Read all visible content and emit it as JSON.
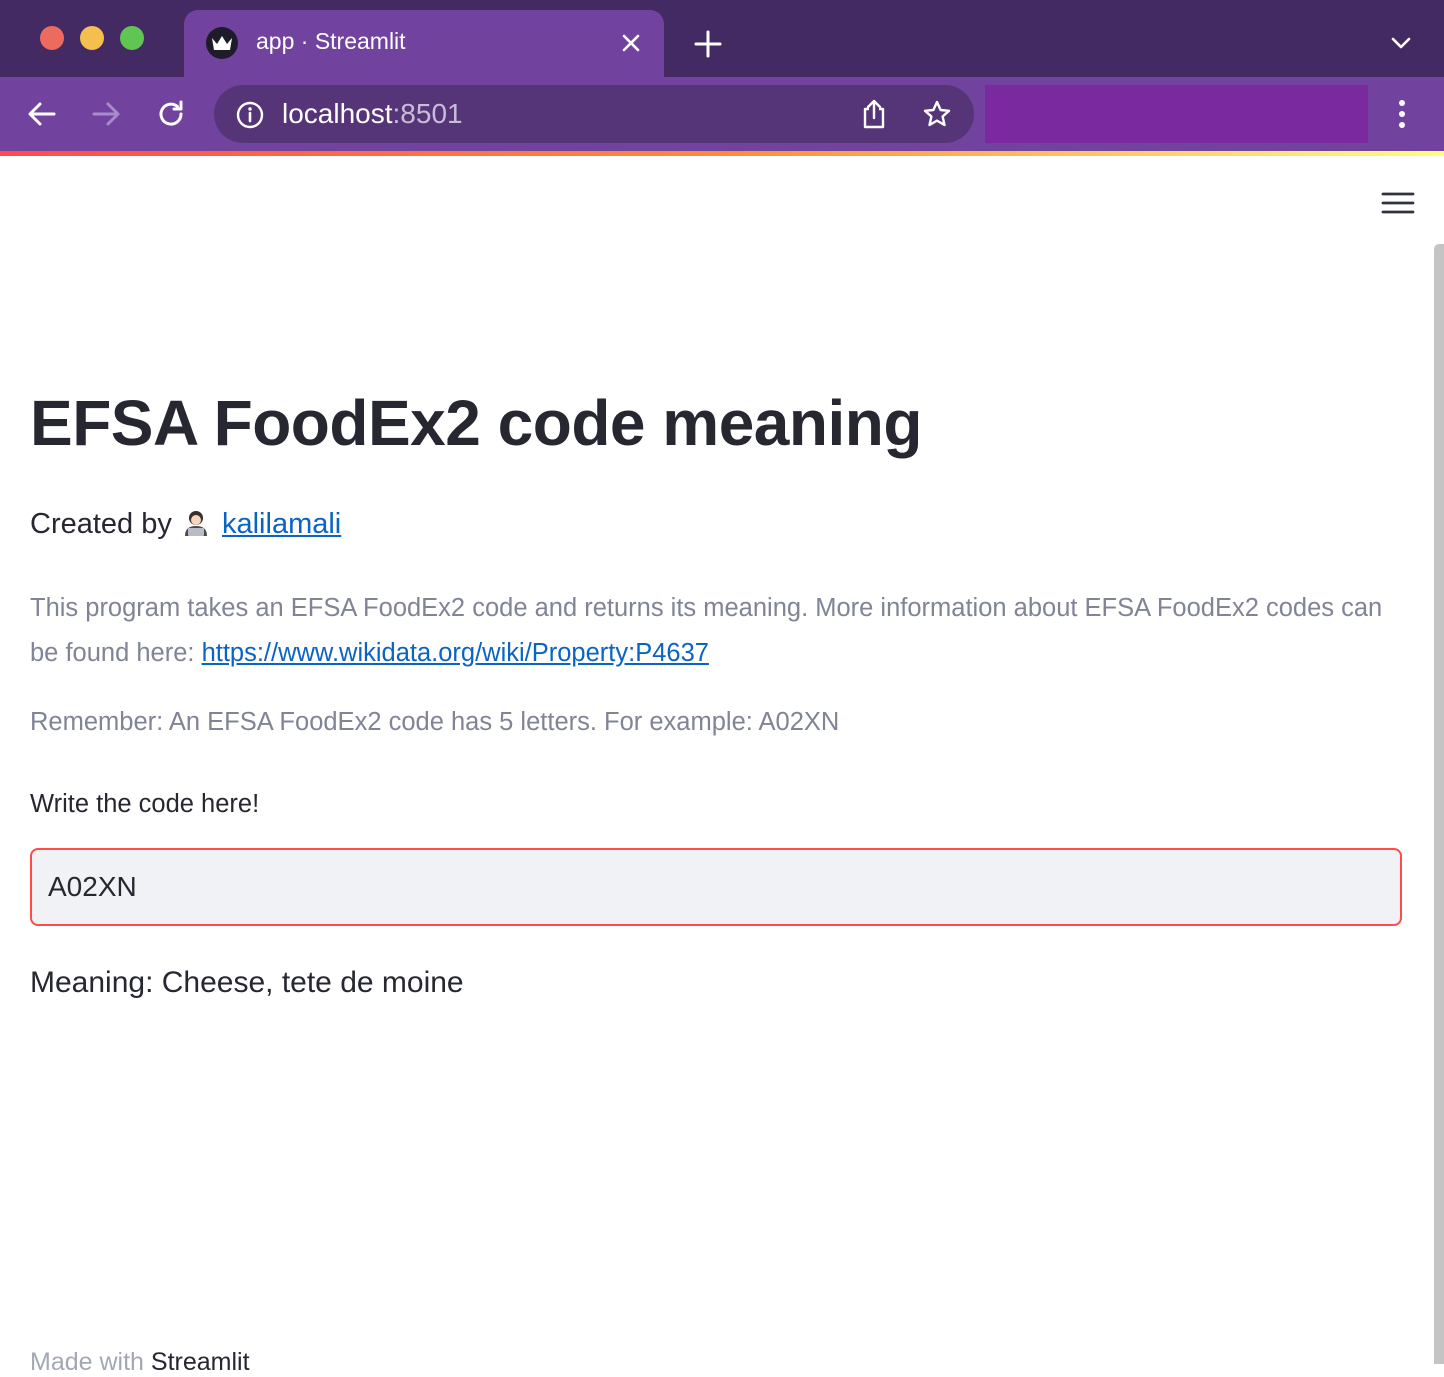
{
  "browser": {
    "tab_title": "app · Streamlit",
    "url_host": "localhost",
    "url_port": ":8501"
  },
  "page": {
    "title": "EFSA FoodEx2 code meaning",
    "created_prefix": "Created by",
    "author_emoji": "technologist-emoji",
    "author_link": "kalilamali",
    "description": "This program takes an EFSA FoodEx2 code and returns its meaning. More information about EFSA FoodEx2 codes can be found here:",
    "description_link": "https://www.wikidata.org/wiki/Property:P4637",
    "remember": "Remember: An EFSA FoodEx2 code has 5 letters. For example: A02XN",
    "input_label": "Write the code here!",
    "input_value": "A02XN",
    "meaning": "Meaning: Cheese, tete de moine"
  },
  "footer": {
    "made_with": "Made with",
    "brand": "Streamlit"
  },
  "colors": {
    "titlebar": "#442a63",
    "toolbar": "#71439f",
    "accent_red": "#ff4b4b",
    "link_blue": "#0b64c4",
    "muted_text": "#808495"
  }
}
